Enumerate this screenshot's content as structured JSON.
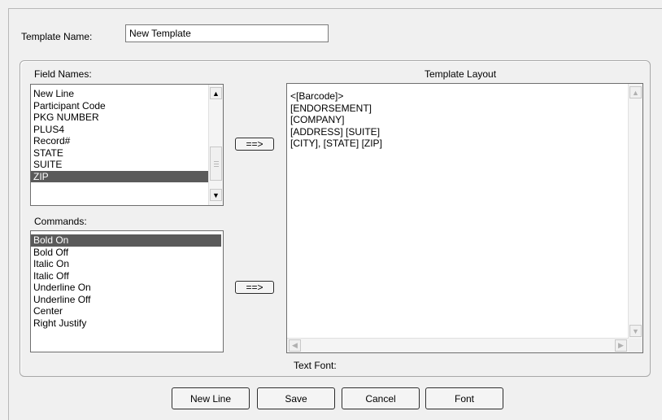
{
  "template_name": {
    "label": "Template Name:",
    "value": "New Template"
  },
  "field_names": {
    "label": "Field Names:",
    "items": [
      "New Line",
      "Participant Code",
      "PKG NUMBER",
      "PLUS4",
      "Record#",
      "STATE",
      "SUITE",
      "ZIP"
    ],
    "selected": "ZIP"
  },
  "commands": {
    "label": "Commands:",
    "items": [
      "Bold On",
      "Bold Off",
      "Italic On",
      "Italic Off",
      "Underline On",
      "Underline Off",
      "Center",
      "Right Justify"
    ],
    "selected": "Bold On"
  },
  "arrow_button_label": "==>",
  "template_layout": {
    "label": "Template Layout",
    "lines": [
      "<[Barcode]>",
      "[ENDORSEMENT]",
      "[COMPANY]",
      "[ADDRESS] [SUITE]",
      "[CITY], [STATE] [ZIP]"
    ]
  },
  "text_font_label": "Text Font:",
  "buttons": {
    "new_line": "New Line",
    "save": "Save",
    "cancel": "Cancel",
    "font": "Font"
  }
}
